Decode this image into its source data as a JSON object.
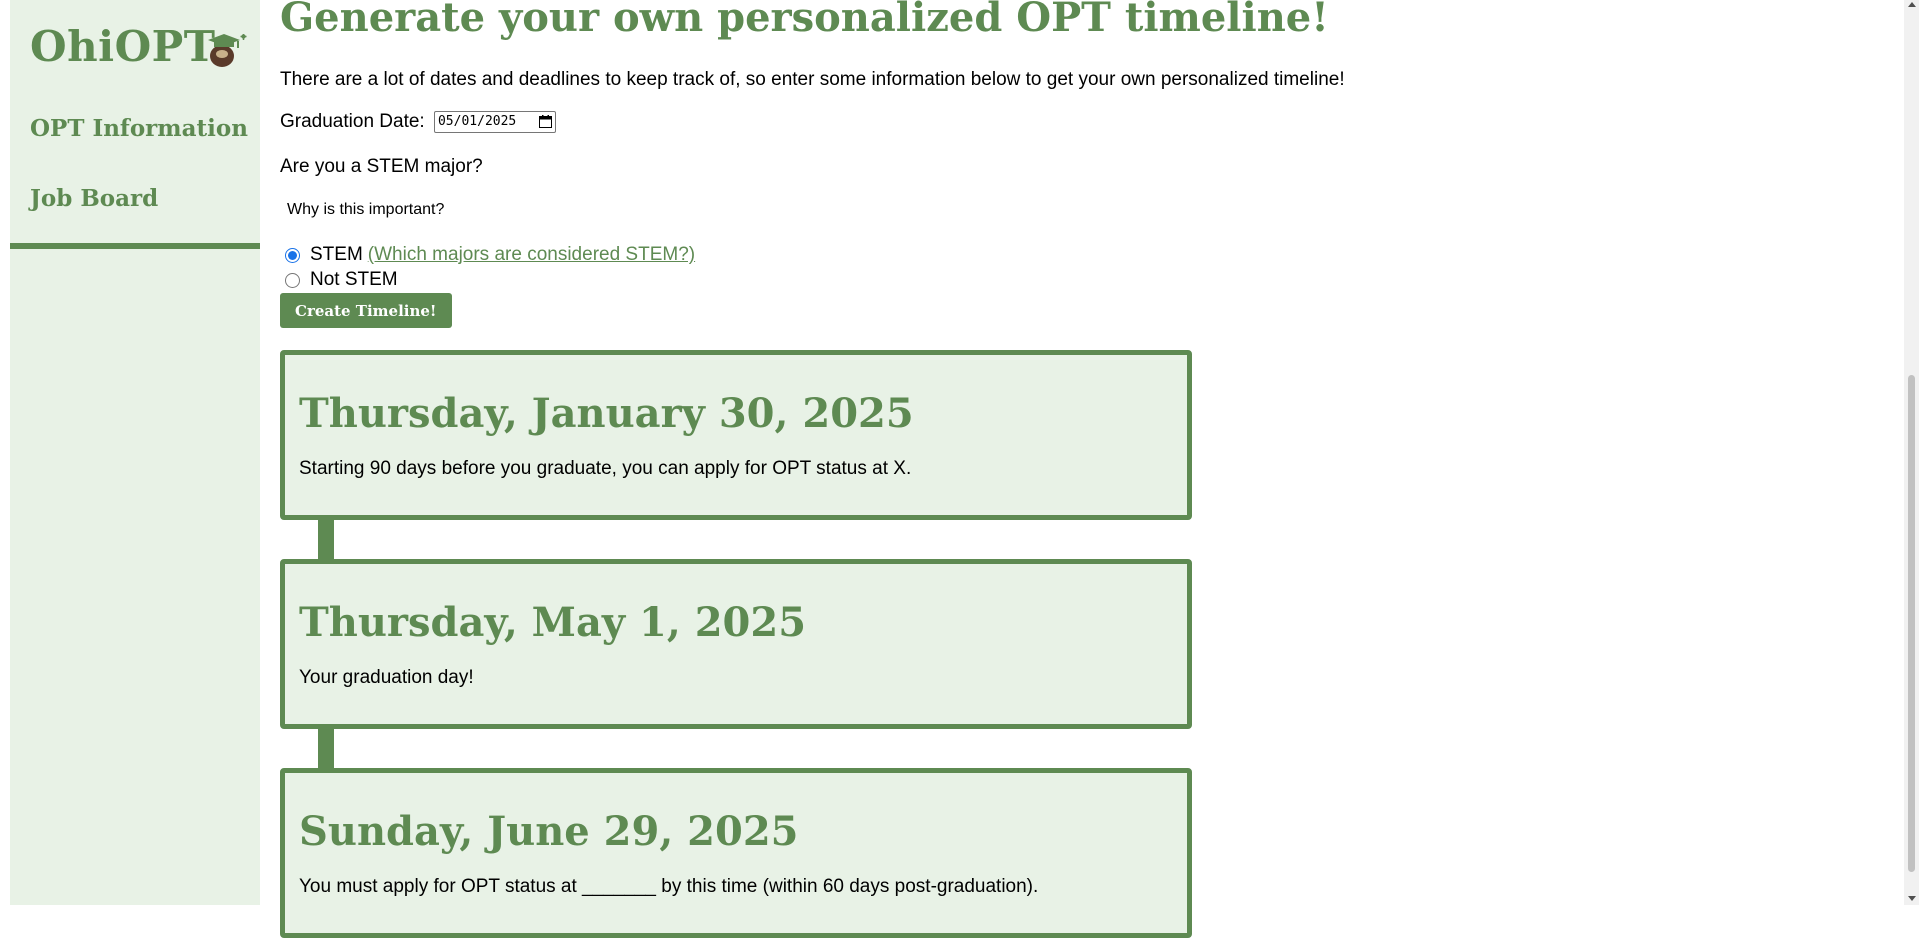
{
  "sidebar": {
    "logo": "OhiOPT",
    "logo_icon": "graduation-cap-buckeye-icon",
    "items": [
      {
        "label": "OPT Information"
      },
      {
        "label": "Job Board"
      }
    ]
  },
  "main": {
    "title": "Generate your own personalized OPT timeline!",
    "intro": "There are a lot of dates and deadlines to keep track of, so enter some information below to get your own personalized timeline!",
    "graduation_label": "Graduation Date:",
    "graduation_value": "05/01/2025",
    "stem_question": "Are you a STEM major?",
    "why_summary": "Why is this important?",
    "radio_stem": "STEM",
    "radio_stem_link": "(Which majors are considered STEM?)",
    "radio_not_stem": "Not STEM",
    "selected": "STEM",
    "create_button": "Create Timeline!"
  },
  "timeline": [
    {
      "date": "Thursday, January 30, 2025",
      "text": "Starting 90 days before you graduate, you can apply for OPT status at X."
    },
    {
      "date": "Thursday, May 1, 2025",
      "text": "Your graduation day!"
    },
    {
      "date": "Sunday, June 29, 2025",
      "text": "You must apply for OPT status at _______ by this time (within 60 days post-graduation)."
    }
  ],
  "colors": {
    "accent": "#5e8a52",
    "card_bg": "#e8f2e6"
  }
}
